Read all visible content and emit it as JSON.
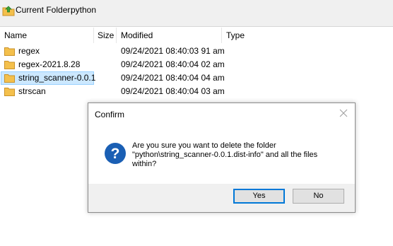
{
  "location": {
    "label": "Current Folder:",
    "value": "python"
  },
  "columns": {
    "name": "Name",
    "size": "Size",
    "modified": "Modified",
    "type": "Type"
  },
  "files": [
    {
      "name": "regex",
      "modified": "09/24/2021 08:40:03 91 am",
      "icon": "folder-icon"
    },
    {
      "name": "regex-2021.8.28",
      "modified": "09/24/2021 08:40:04 02 am",
      "icon": "folder-icon"
    },
    {
      "name": "string_scanner-0.0.1",
      "modified": "09/24/2021 08:40:04 04 am",
      "icon": "folder-icon",
      "selected": true
    },
    {
      "name": "strscan",
      "modified": "09/24/2021 08:40:04 03 am",
      "icon": "folder-icon"
    }
  ],
  "dialog": {
    "title": "Confirm",
    "message_line1": "Are you sure you want to delete the folder",
    "message_line2": "\"python\\string_scanner-0.0.1.dist-info\" and all the files",
    "message_line3": "within?",
    "yes_label": "Yes",
    "no_label": "No",
    "icon": "question-icon"
  },
  "colors": {
    "selection": "#cce8ff",
    "folder": "#f4c04c",
    "question": "#1a5fb4",
    "accent": "#0078d7"
  }
}
